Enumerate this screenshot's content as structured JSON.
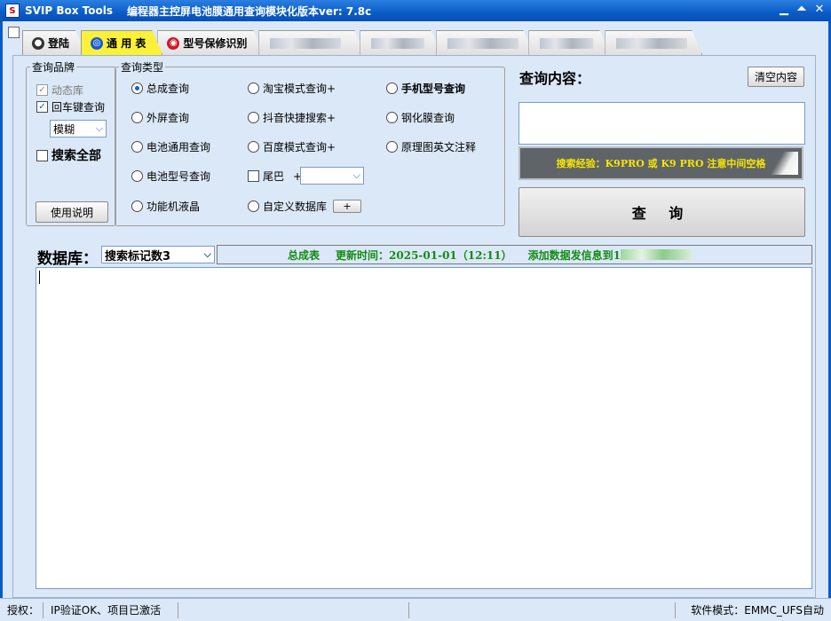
{
  "window": {
    "name": "SVIP Box Tools",
    "description": "编程器主控屏电池膜通用查询模块化版本ver: 7.8c",
    "app_icon_glyph": "S",
    "controls": {
      "minimize": "▁",
      "restore": "⏶",
      "close": "✕"
    }
  },
  "tabs": [
    {
      "label": "登陆",
      "icon": "login-icon",
      "active": false
    },
    {
      "label": "通 用 表",
      "icon": "search-icon",
      "active": true
    },
    {
      "label": "型号保修识别",
      "icon": "warranty-icon",
      "active": false
    }
  ],
  "brand_group": {
    "legend": "查询品牌",
    "dynamic_lib": "动态库",
    "enter_query": "回车键查询",
    "mode_value": "模糊",
    "search_all": "搜索全部",
    "help_button": "使用说明"
  },
  "type_group": {
    "legend": "查询类型",
    "col1": [
      "总成查询",
      "外屏查询",
      "电池通用查询",
      "电池型号查询",
      "功能机液晶"
    ],
    "col2": [
      "淘宝模式查询+",
      "抖音快捷搜索+",
      "百度模式查询+",
      "尾巴",
      "自定义数据库"
    ],
    "col3": [
      "手机型号查询",
      "钢化膜查询",
      "原理图英文注释"
    ],
    "tail_plus": "+",
    "custom_db_plus": "+",
    "selected": "总成查询"
  },
  "query": {
    "title": "查询内容：",
    "clear_button": "清空内容",
    "input_value": "",
    "tip": "搜索经验：K9PRO   或   K9 PRO   注意中间空格",
    "search_button": "查 询"
  },
  "database": {
    "label": "数据库：",
    "select_value": "搜索标记数3",
    "table_name": "总成表",
    "update_text": "更新时间：2025-01-01（12:11）",
    "add_text": "添加数据发信息到1"
  },
  "status": {
    "auth_label": "授权：",
    "auth_value": "IP验证OK、项目已激活",
    "mode_text": "软件模式：EMMC_UFS自动"
  }
}
